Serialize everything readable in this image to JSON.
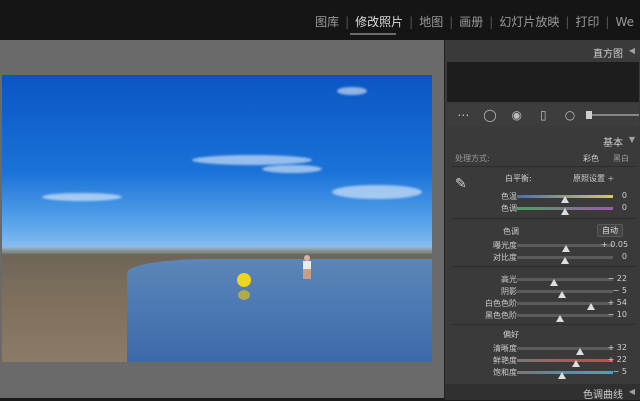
{
  "modules": [
    {
      "label": "图库"
    },
    {
      "label": "修改照片"
    },
    {
      "label": "地图"
    },
    {
      "label": "画册"
    },
    {
      "label": "幻灯片放映"
    },
    {
      "label": "打印"
    },
    {
      "label": "We"
    }
  ],
  "panel": {
    "histogram_title": "直方图",
    "basic_title": "基本",
    "treatment_label": "处理方式:",
    "treatment_color": "彩色",
    "treatment_bw": "黑白",
    "wb_label": "白平衡:",
    "wb_value": "原照设置 ÷",
    "temp_label": "色温",
    "temp_value": "0",
    "tint_label": "色调",
    "tint_value": "0",
    "tone_label": "色调",
    "auto_label": "自动",
    "exposure_label": "曝光度",
    "exposure_value": "+ 0.05",
    "contrast_label": "对比度",
    "contrast_value": "0",
    "highlights_label": "高光",
    "highlights_value": "− 22",
    "shadows_label": "阴影",
    "shadows_value": "− 5",
    "whites_label": "白色色阶",
    "whites_value": "+ 54",
    "blacks_label": "黑色色阶",
    "blacks_value": "− 10",
    "presence_label": "偏好",
    "clarity_label": "清晰度",
    "clarity_value": "+ 32",
    "vibrance_label": "鲜艳度",
    "vibrance_value": "+ 22",
    "saturation_label": "饱和度",
    "saturation_value": "− 5",
    "tone_curve_title": "色调曲线"
  },
  "slider_levels": {
    "temp": 0.5,
    "tint": 0.5,
    "exposure": 0.51,
    "contrast": 0.5,
    "highlights": 0.39,
    "shadows": 0.47,
    "whites": 0.77,
    "blacks": 0.45,
    "clarity": 0.66,
    "vibrance": 0.61,
    "saturation": 0.47
  },
  "colors": {
    "accent": "#dedede",
    "panel_bg": "#3a3a3a",
    "canvas_bg": "#6a6a6a"
  }
}
